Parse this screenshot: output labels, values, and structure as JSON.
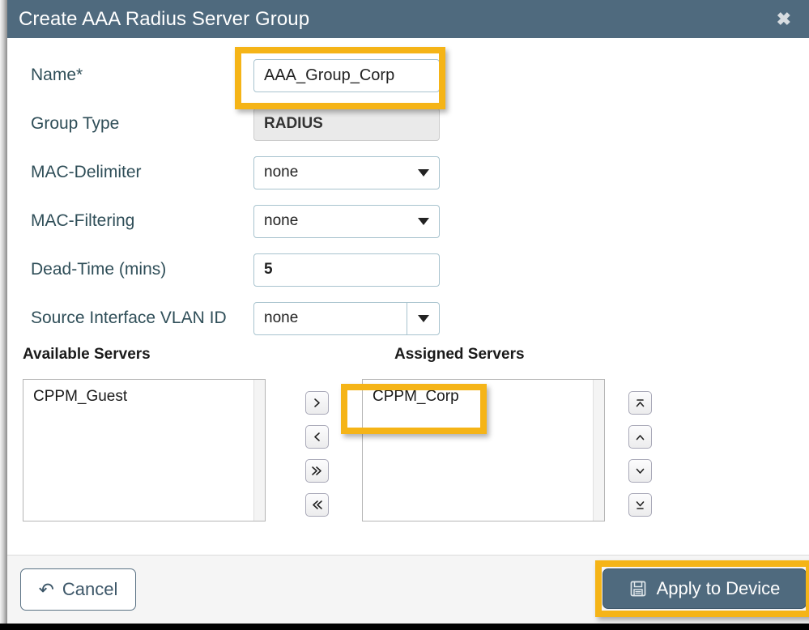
{
  "dialog": {
    "title": "Create AAA Radius Server Group",
    "close_label": "✖"
  },
  "form": {
    "rows": [
      {
        "label": "Name*",
        "value": "AAA_Group_Corp",
        "type": "text"
      },
      {
        "label": "Group Type",
        "value": "RADIUS",
        "type": "readonly"
      },
      {
        "label": "MAC-Delimiter",
        "value": "none",
        "type": "select"
      },
      {
        "label": "MAC-Filtering",
        "value": "none",
        "type": "select"
      },
      {
        "label": "Dead-Time (mins)",
        "value": "5",
        "type": "number"
      },
      {
        "label": "Source Interface VLAN ID",
        "value": "none",
        "type": "select-split"
      }
    ]
  },
  "servers": {
    "available_heading": "Available Servers",
    "assigned_heading": "Assigned Servers",
    "available_items": [
      "CPPM_Guest"
    ],
    "assigned_items": [
      "CPPM_Corp"
    ],
    "transfer_buttons": [
      {
        "name": "move-right-button",
        "glyph": "›"
      },
      {
        "name": "move-left-button",
        "glyph": "‹"
      },
      {
        "name": "move-all-right-button",
        "glyph": "»"
      },
      {
        "name": "move-all-left-button",
        "glyph": "«"
      }
    ],
    "order_buttons": [
      {
        "name": "move-to-top-button",
        "glyph": "top"
      },
      {
        "name": "move-up-button",
        "glyph": "up"
      },
      {
        "name": "move-down-button",
        "glyph": "down"
      },
      {
        "name": "move-to-bottom-button",
        "glyph": "bottom"
      }
    ]
  },
  "footer": {
    "cancel_label": "Cancel",
    "apply_label": "Apply to Device"
  },
  "colors": {
    "titlebar": "#4f6a7e",
    "highlight": "#f5b417",
    "label_text": "#2f4e58",
    "control_border": "#a8c3ce",
    "footer_bg": "#f5f5f5",
    "apply_bg": "#4f6a7e"
  }
}
